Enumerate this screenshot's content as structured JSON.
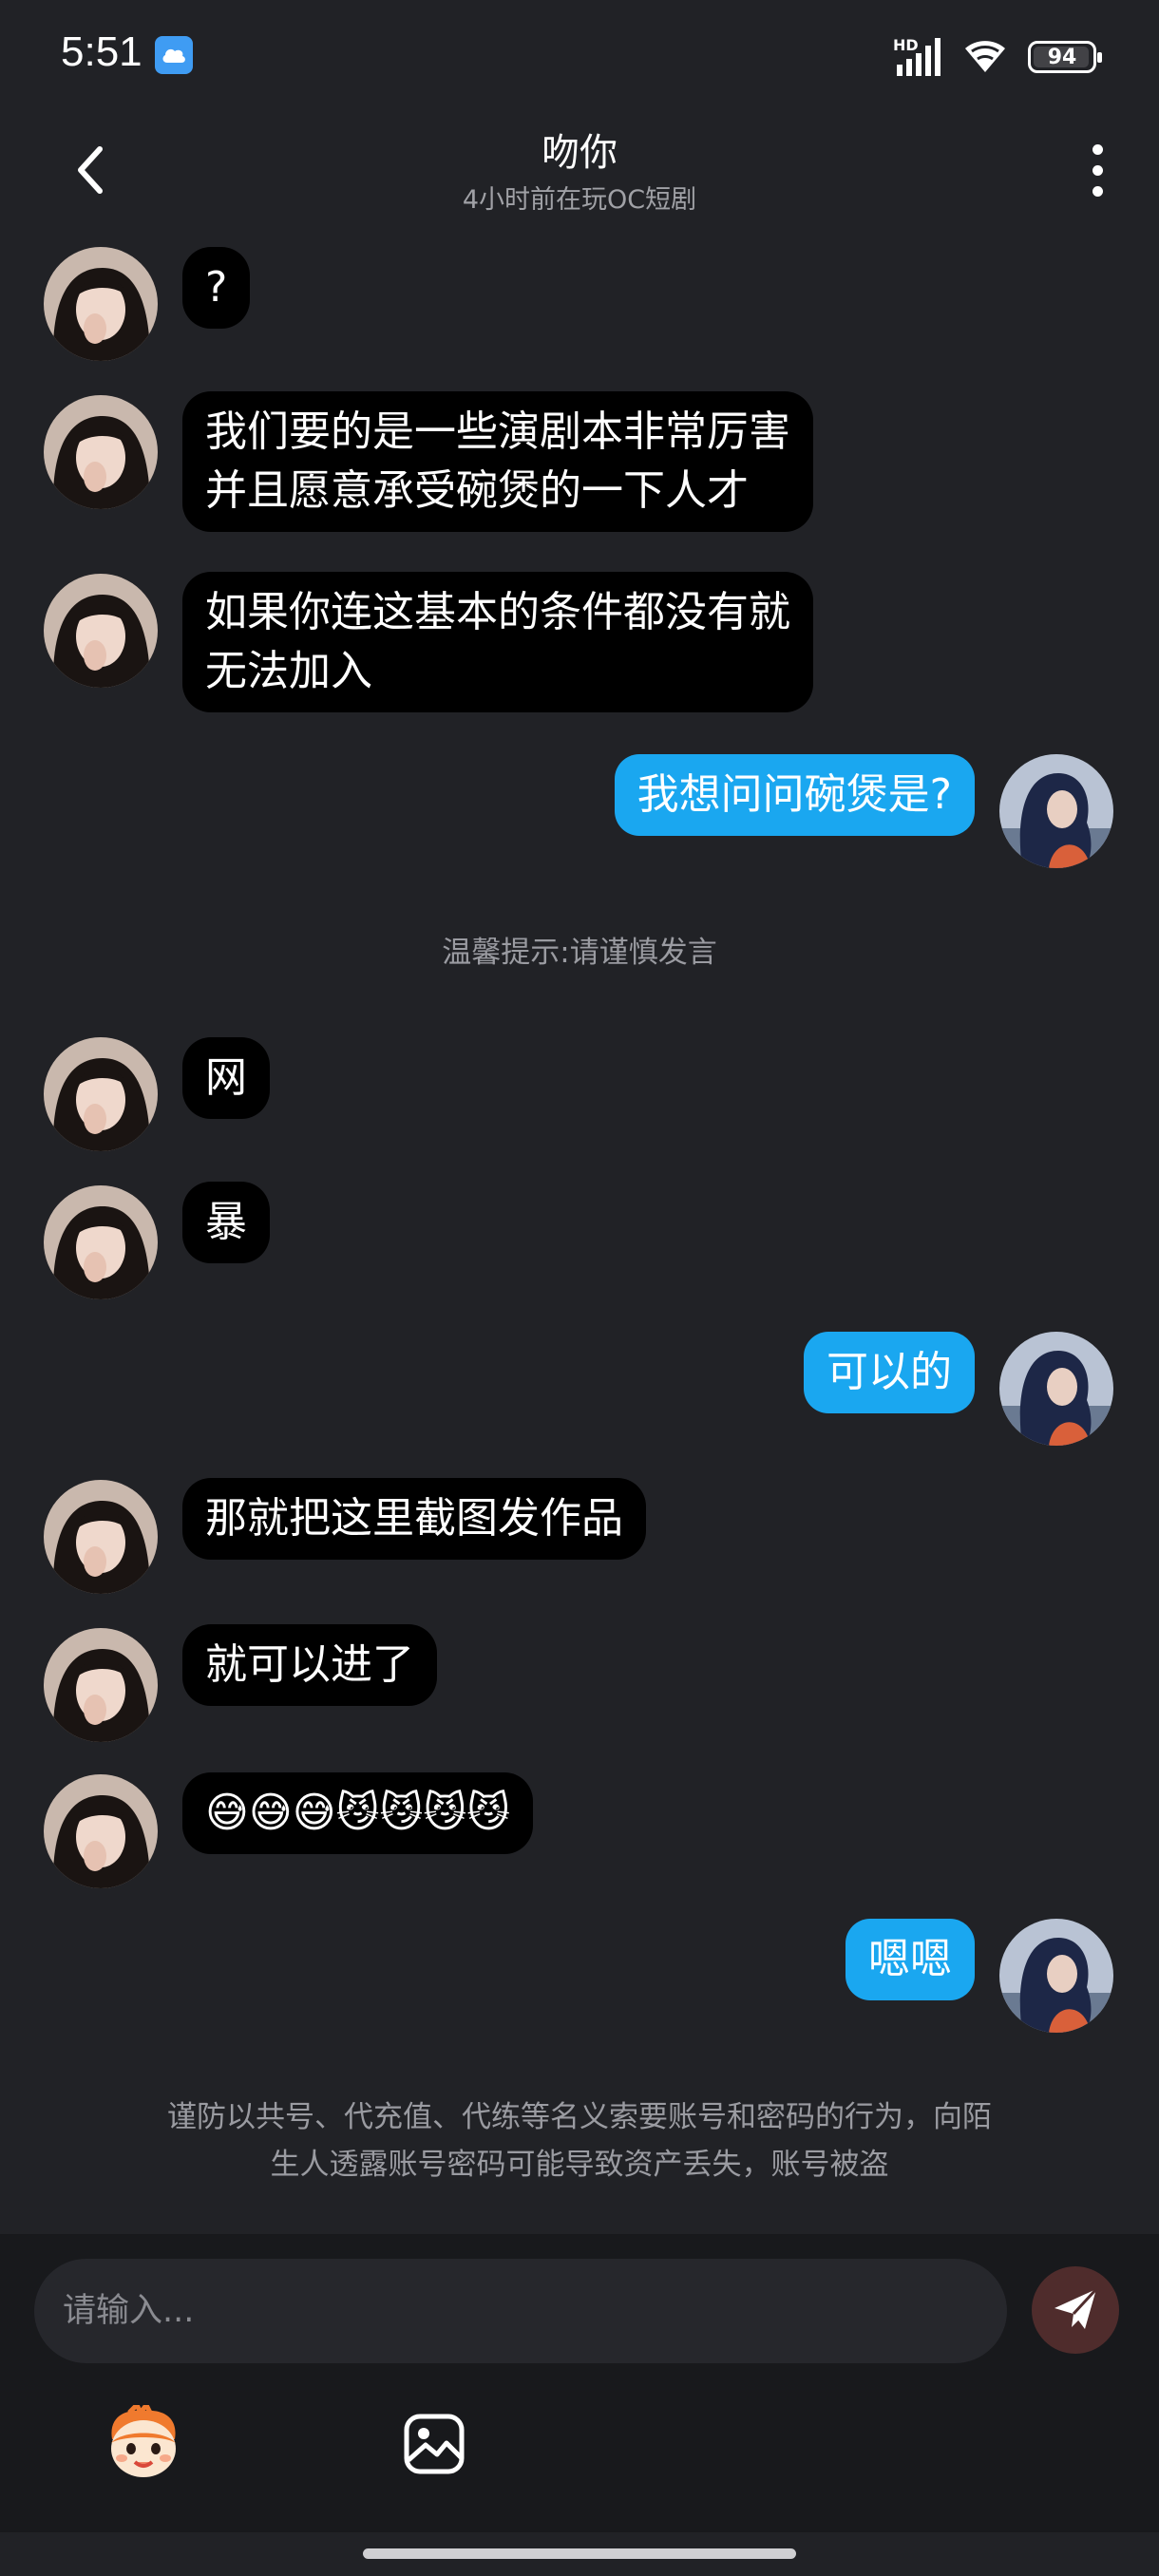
{
  "status_bar": {
    "time": "5:51",
    "hd_label": "HD",
    "battery": "94",
    "icons": [
      "cloud-app-icon",
      "hd-signal-icon",
      "wifi-icon",
      "battery-icon"
    ]
  },
  "header": {
    "title": "吻你",
    "subtitle": "4小时前在玩OC短剧",
    "icons": [
      "back-arrow-icon",
      "more-vertical-icon"
    ]
  },
  "messages": [
    {
      "side": "left",
      "text": "?"
    },
    {
      "side": "left",
      "lines": [
        "我们要的是一些演剧本非常厉害",
        "并且愿意承受碗煲的一下人才"
      ]
    },
    {
      "side": "left",
      "lines": [
        "如果你连这基本的条件都没有就",
        "无法加入"
      ]
    },
    {
      "side": "right",
      "text": "我想问问碗煲是?"
    },
    {
      "side": "left",
      "text": "网"
    },
    {
      "side": "left",
      "text": "暴"
    },
    {
      "side": "right",
      "text": "可以的"
    },
    {
      "side": "left",
      "text": "那就把这里截图发作品"
    },
    {
      "side": "left",
      "text": "就可以进了"
    },
    {
      "side": "left",
      "text": "😅😅😅😼😼😼😼"
    },
    {
      "side": "right",
      "text": "嗯嗯"
    }
  ],
  "system_tip": "温馨提示:请谨慎发言",
  "safety_notice": {
    "line1": "谨防以共号、代充值、代练等名义索要账号和密码的行为，向陌",
    "line2": "生人透露账号密码可能导致资产丢失，账号被盗"
  },
  "composer": {
    "placeholder": "请输入...",
    "icons": [
      "send-icon",
      "emoji-mascot-icon",
      "image-icon"
    ]
  },
  "colors": {
    "background": "#212226",
    "incoming_bubble": "#000000",
    "outgoing_bubble": "#1aa7f0",
    "send_button": "#4f2c2c"
  }
}
